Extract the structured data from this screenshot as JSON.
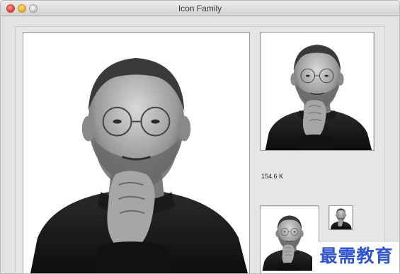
{
  "window": {
    "title": "Icon Family"
  },
  "file_size": "154.6 K",
  "watermark_text": "最需教育",
  "colors": {
    "watermark": "#2f54d6",
    "close_button": "#e0443e",
    "minimize_button": "#e8b12f",
    "zoom_button": "#cfcfcf"
  }
}
